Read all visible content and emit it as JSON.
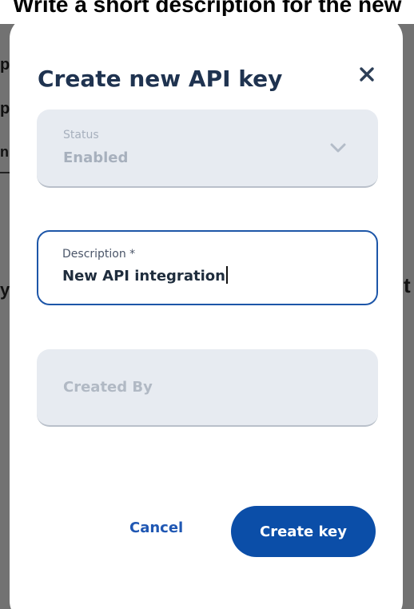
{
  "instruction": {
    "text": "Write a short description for the new"
  },
  "backdrop": {
    "fragment_1": "p",
    "fragment_2": "p",
    "fragment_3": "n",
    "fragment_4": "y",
    "fragment_5": "t"
  },
  "modal": {
    "title": "Create new API key",
    "close_icon": "close-icon",
    "fields": {
      "status": {
        "label": "Status",
        "value": "Enabled",
        "icon": "chevron-down-icon"
      },
      "description": {
        "label": "Description *",
        "value": "New API integration"
      },
      "created_by": {
        "placeholder": "Created By",
        "value": ""
      }
    },
    "actions": {
      "cancel_label": "Cancel",
      "create_label": "Create key"
    }
  },
  "colors": {
    "title": "#1f3350",
    "primary": "#0b4ea8",
    "focus_border": "#1d56a8",
    "disabled_bg": "#e7ebf1"
  }
}
